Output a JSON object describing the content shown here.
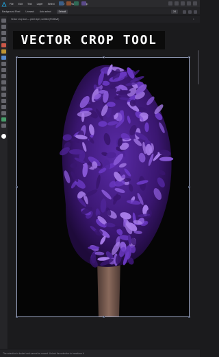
{
  "menu": {
    "items": [
      "File",
      "Edit",
      "Text",
      "Layer",
      "Select",
      "View",
      "Window",
      "Help"
    ]
  },
  "context_bar": {
    "layer_name": "Background Pixel",
    "mode_label": "Unmask",
    "ratio_label": "Auto select",
    "preset_value": "Default",
    "zoom": "24"
  },
  "document": {
    "tab_title": "Vector crop tool — pixel layer, untitled (RGBA/8)",
    "close_glyph": "×"
  },
  "overlay": {
    "title": "VECTOR CROP TOOL"
  },
  "status": {
    "text": "The selection is locked and cannot be moved. Unlock the selection to transform it."
  },
  "colors": {
    "accent": "#6a3bbf",
    "crop_frame": "#9fa9c7",
    "flower_dark": "#3a1670",
    "flower_mid": "#6a38c2",
    "flower_light": "#a77ce8",
    "stem": "#7b5a4f"
  },
  "tools": [
    {
      "icon": "move-tool-icon",
      "color": "#9b9ba4"
    },
    {
      "icon": "artboard-tool-icon",
      "color": "#9b9ba4"
    },
    {
      "icon": "view-tool-icon",
      "color": "#9b9ba4"
    },
    {
      "icon": "zoom-tool-icon",
      "color": "#9b9ba4"
    },
    {
      "icon": "pen-tool-icon",
      "color": "#d45b4a"
    },
    {
      "icon": "brush-tool-icon",
      "color": "#c79a34"
    },
    {
      "icon": "vector-crop-tool-icon",
      "color": "#5a8fd6"
    },
    {
      "icon": "fill-tool-icon",
      "color": "#9b9ba4"
    },
    {
      "icon": "gradient-tool-icon",
      "color": "#9b9ba4"
    },
    {
      "icon": "transparency-tool-icon",
      "color": "#9b9ba4"
    },
    {
      "icon": "rectangle-tool-icon",
      "color": "#9b9ba4"
    },
    {
      "icon": "ellipse-tool-icon",
      "color": "#9b9ba4"
    },
    {
      "icon": "shape-tool-icon",
      "color": "#9b9ba4"
    },
    {
      "icon": "text-tool-icon",
      "color": "#9b9ba4"
    },
    {
      "icon": "table-tool-icon",
      "color": "#9b9ba4"
    },
    {
      "icon": "place-image-icon",
      "color": "#9b9ba4"
    },
    {
      "icon": "color-picker-icon",
      "color": "#4aa36e"
    },
    {
      "icon": "eyedropper-icon",
      "color": "#9b9ba4"
    }
  ]
}
